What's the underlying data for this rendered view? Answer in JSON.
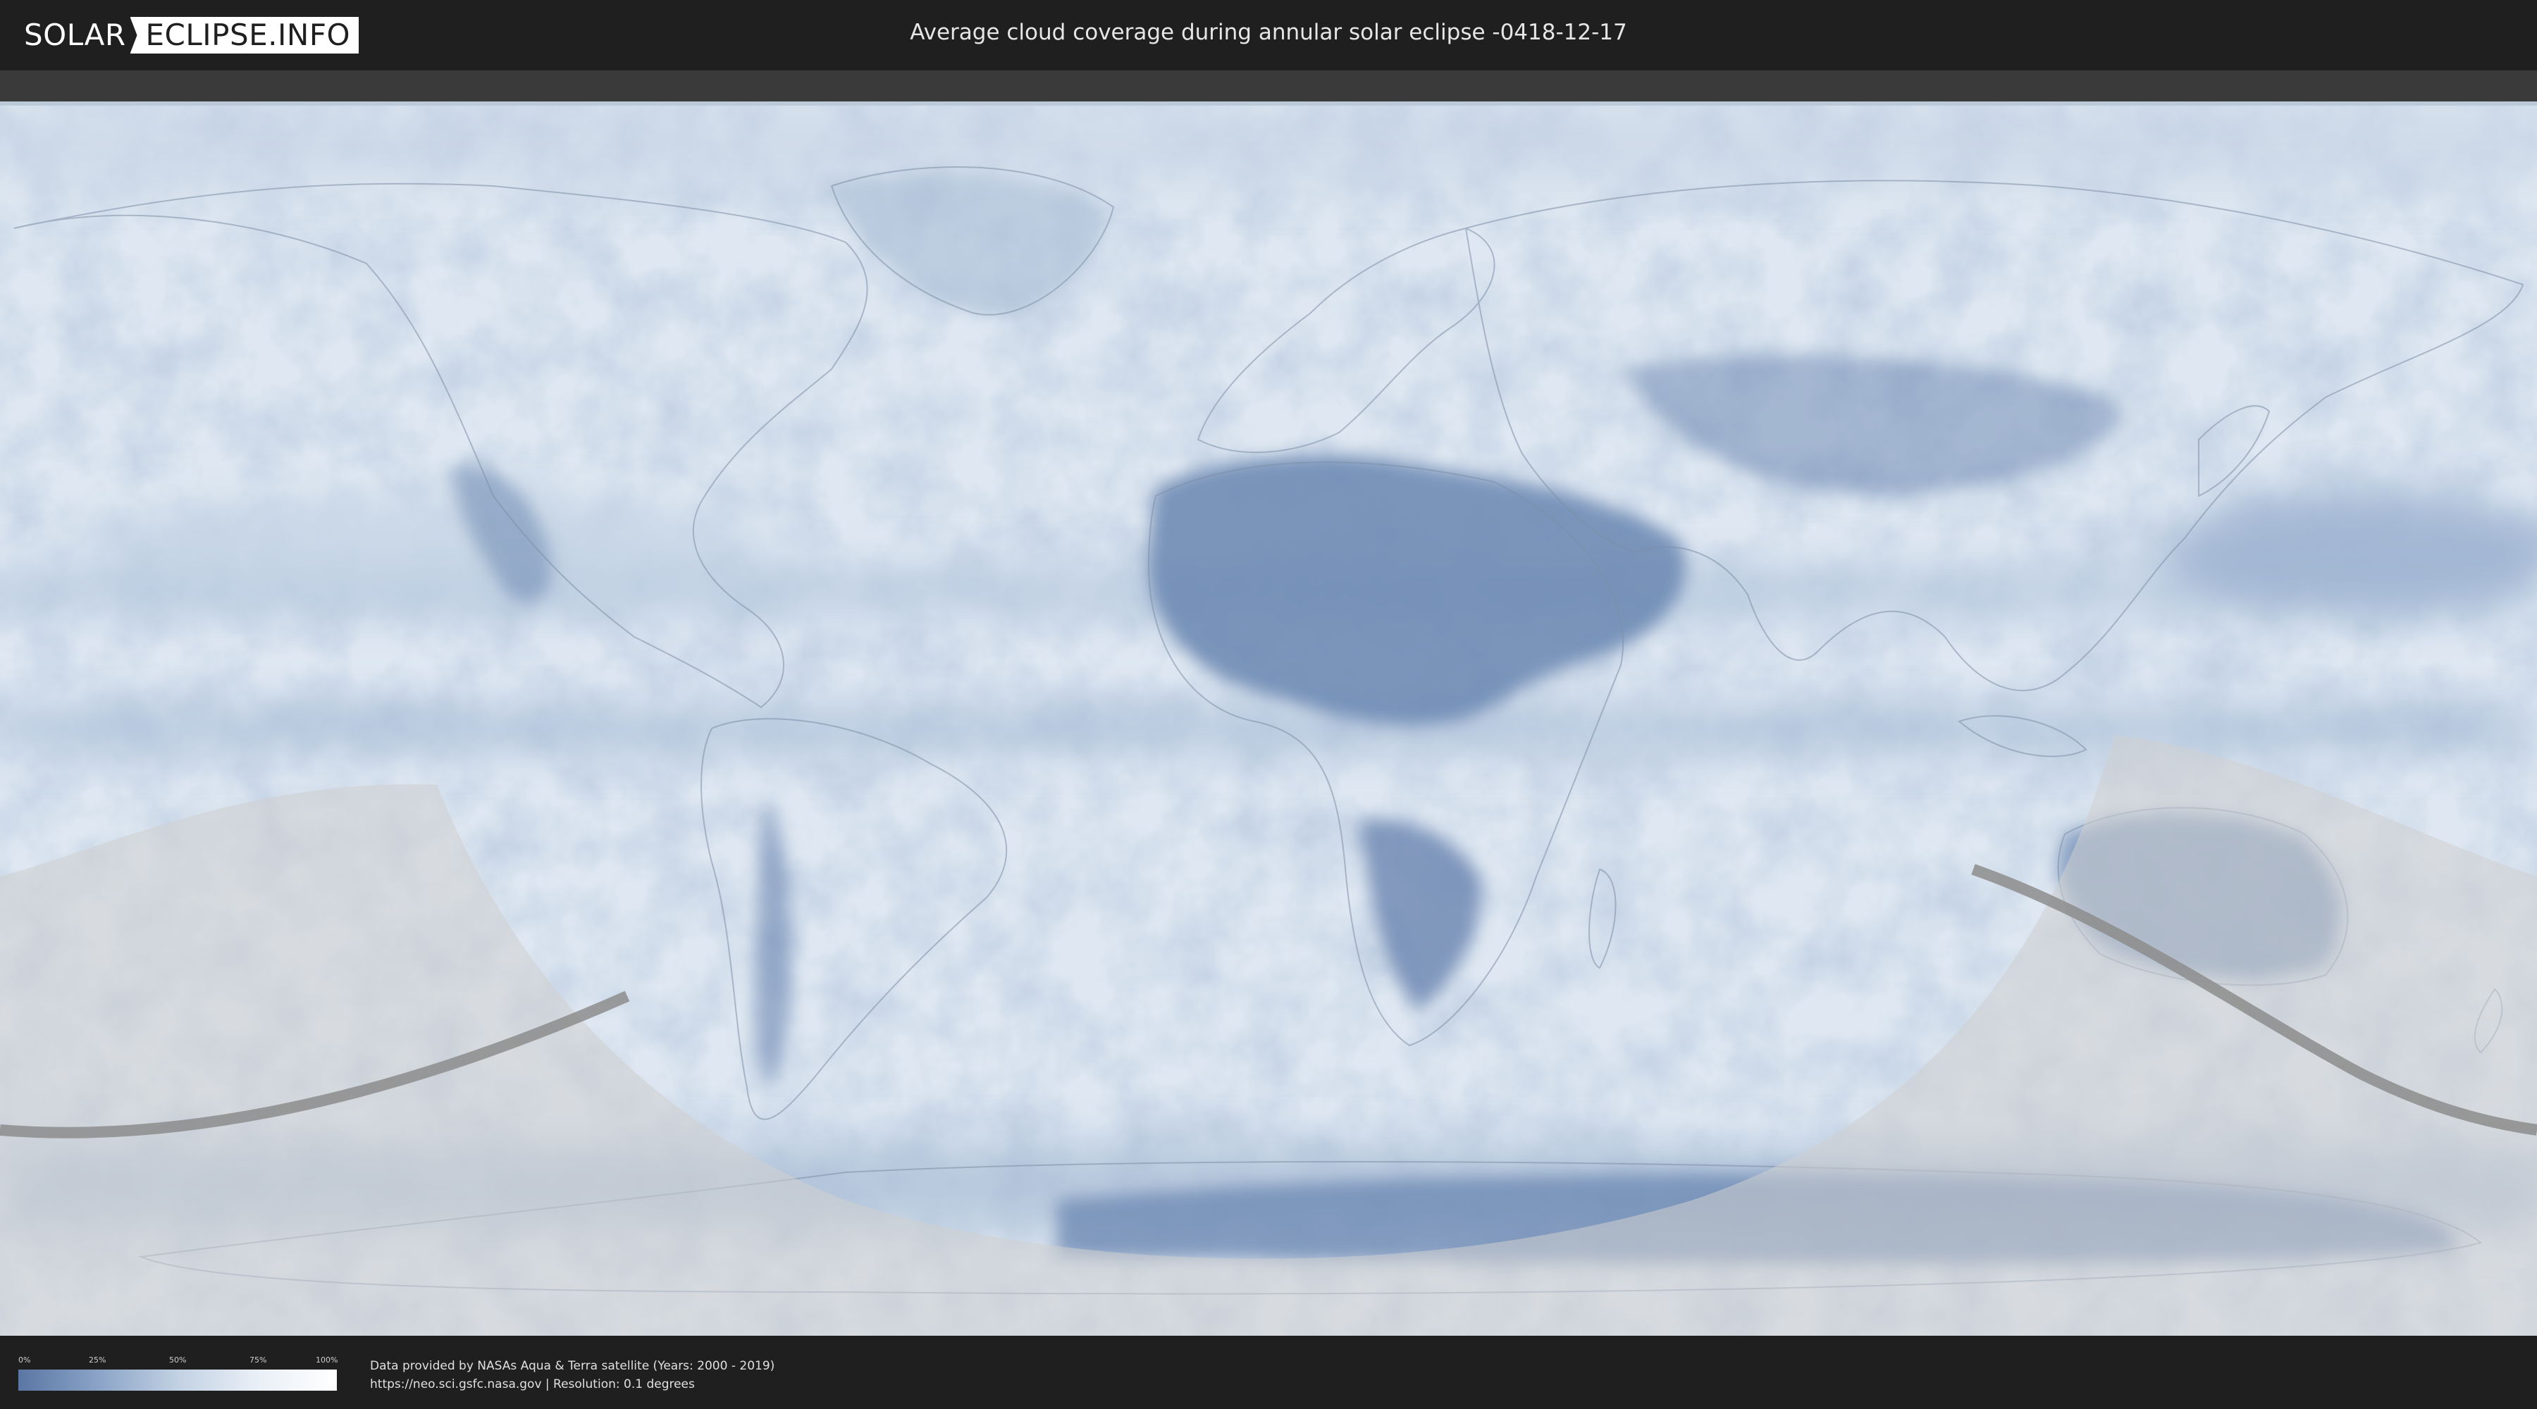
{
  "header": {
    "logo_left": "SOLAR",
    "logo_right": "ECLIPSE.INFO",
    "title": "Average cloud coverage during annular solar eclipse -0418-12-17"
  },
  "legend": {
    "ticks": [
      "0%",
      "25%",
      "50%",
      "75%",
      "100%"
    ],
    "colors": {
      "low": "#5a76a4",
      "high": "#ffffff"
    }
  },
  "footer": {
    "line1": "Data provided by NASAs Aqua & Terra satellite (Years: 2000 - 2019)",
    "line2": "https://neo.sci.gsfc.nasa.gov | Resolution: 0.1 degrees"
  },
  "map": {
    "background_color": "#dfe8f2",
    "cloud_dark_color": "#6683ad",
    "shadow_color": "#bdbdbd",
    "path_color": "#8c8c8c"
  }
}
